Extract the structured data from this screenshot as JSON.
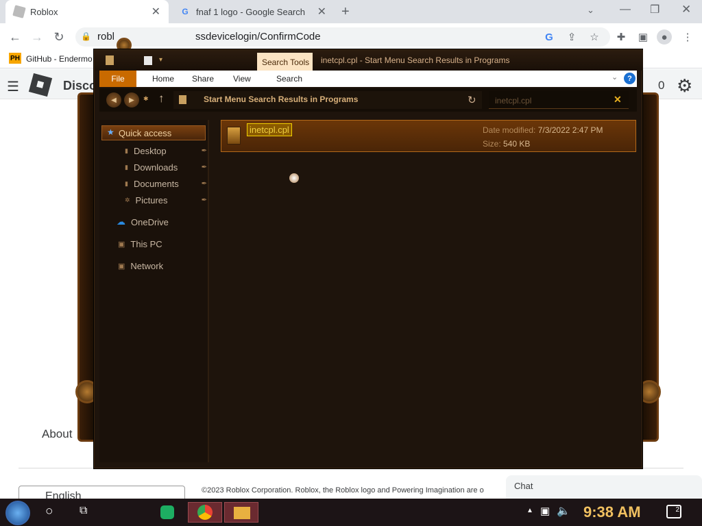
{
  "browser": {
    "tabs": [
      {
        "title": "Roblox",
        "active": true
      },
      {
        "title": "fnaf 1 logo - Google Search",
        "active": false
      }
    ],
    "url": "roblox.com/crossdevicelogin/ConfirmCode",
    "url_shown": "robl",
    "url_tail": "ssdevicelogin/ConfirmCode",
    "bookmarks": [
      {
        "badge": "PH",
        "label": "GitHub - Endermo"
      }
    ]
  },
  "roblox": {
    "nav_partial": "Disco",
    "robux": "0",
    "footer_about": "About",
    "language": "English",
    "copyright": "©2023 Roblox Corporation. Roblox, the Roblox logo and Powering Imagination are o",
    "chat": "Chat"
  },
  "explorer": {
    "window_title": "inetcpl.cpl - Start Menu Search Results in Programs",
    "context_tab": "Search Tools",
    "ribbon_tabs": [
      "File",
      "Home",
      "Share",
      "View",
      "Search"
    ],
    "breadcrumb": "Start Menu Search Results in Programs",
    "search_query": "inetcpl.cpl",
    "nav": {
      "quick_access": "Quick access",
      "pinned": [
        "Desktop",
        "Downloads",
        "Documents",
        "Pictures"
      ],
      "onedrive": "OneDrive",
      "this_pc": "This PC",
      "network": "Network"
    },
    "result": {
      "name": "inetcpl.cpl",
      "date_label": "Date modified:",
      "date": "7/3/2022 2:47 PM",
      "size_label": "Size:",
      "size": "540 KB"
    }
  },
  "taskbar": {
    "clock": "9:38 AM",
    "notifications": "2"
  },
  "colors": {
    "accent": "#c96a00",
    "steampunk_bg": "#1e140c",
    "selection": "#f2d000"
  }
}
